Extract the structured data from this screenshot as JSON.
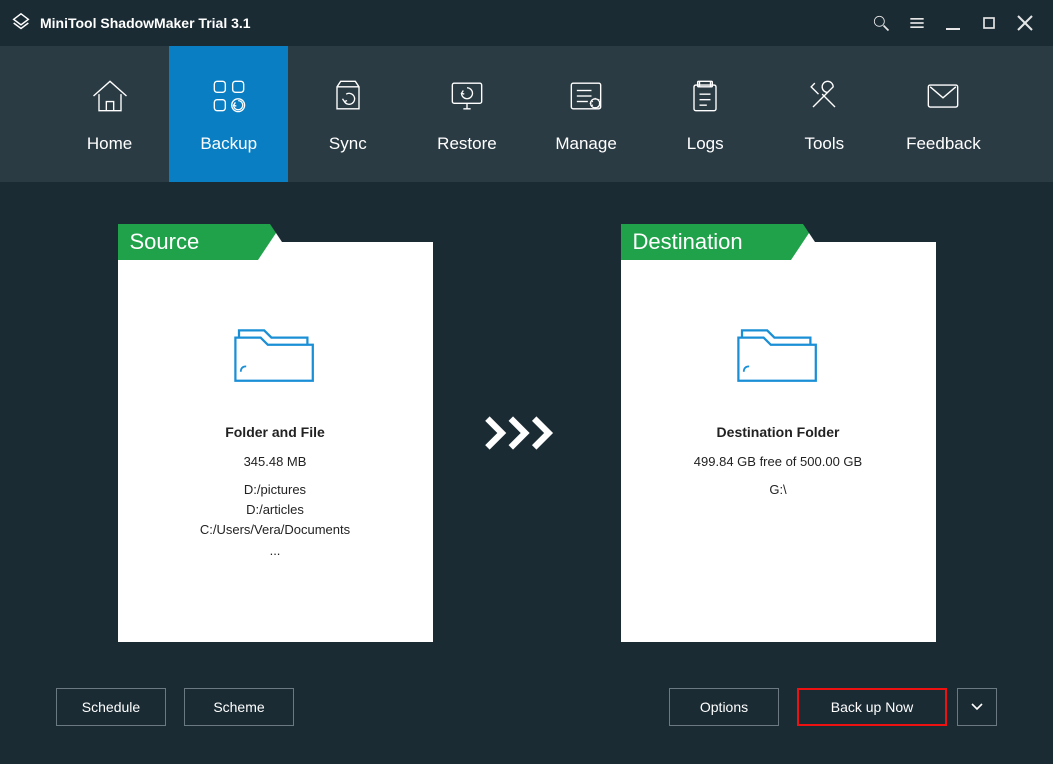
{
  "title": "MiniTool ShadowMaker Trial 3.1",
  "nav": {
    "items": [
      {
        "label": "Home"
      },
      {
        "label": "Backup"
      },
      {
        "label": "Sync"
      },
      {
        "label": "Restore"
      },
      {
        "label": "Manage"
      },
      {
        "label": "Logs"
      },
      {
        "label": "Tools"
      },
      {
        "label": "Feedback"
      }
    ],
    "activeIndex": 1
  },
  "source": {
    "header": "Source",
    "title": "Folder and File",
    "size": "345.48 MB",
    "paths": [
      "D:/pictures",
      "D:/articles",
      "C:/Users/Vera/Documents",
      "..."
    ]
  },
  "destination": {
    "header": "Destination",
    "title": "Destination Folder",
    "free": "499.84 GB free of 500.00 GB",
    "drive": "G:\\"
  },
  "buttons": {
    "schedule": "Schedule",
    "scheme": "Scheme",
    "options": "Options",
    "backupNow": "Back up Now"
  }
}
